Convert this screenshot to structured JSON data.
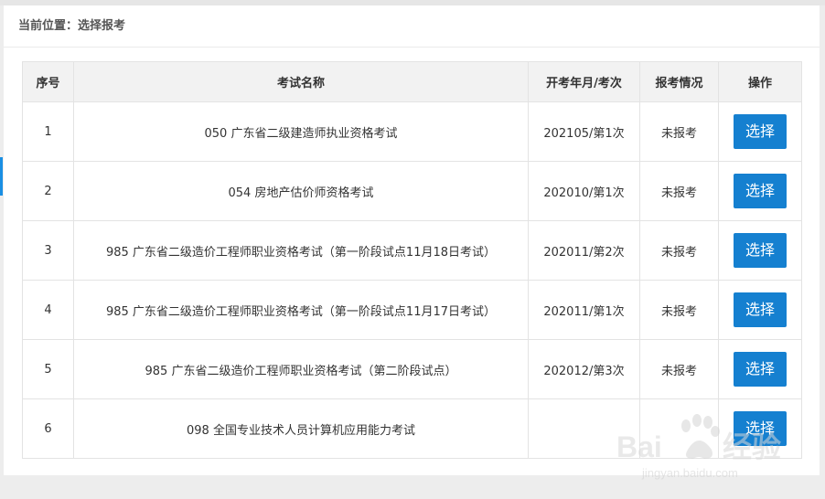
{
  "breadcrumb": {
    "prefix": "当前位置：",
    "current": "选择报考"
  },
  "table": {
    "headers": [
      "序号",
      "考试名称",
      "开考年月/考次",
      "报考情况",
      "操作"
    ],
    "rows": [
      {
        "index": "1",
        "name": "050 广东省二级建造师执业资格考试",
        "period": "202105/第1次",
        "status": "未报考",
        "action": "选择"
      },
      {
        "index": "2",
        "name": "054 房地产估价师资格考试",
        "period": "202010/第1次",
        "status": "未报考",
        "action": "选择"
      },
      {
        "index": "3",
        "name": "985 广东省二级造价工程师职业资格考试（第一阶段试点11月18日考试）",
        "period": "202011/第2次",
        "status": "未报考",
        "action": "选择"
      },
      {
        "index": "4",
        "name": "985 广东省二级造价工程师职业资格考试（第一阶段试点11月17日考试）",
        "period": "202011/第1次",
        "status": "未报考",
        "action": "选择"
      },
      {
        "index": "5",
        "name": "985 广东省二级造价工程师职业资格考试（第二阶段试点）",
        "period": "202012/第3次",
        "status": "未报考",
        "action": "选择"
      },
      {
        "index": "6",
        "name": "098 全国专业技术人员计算机应用能力考试",
        "period": "",
        "status": "",
        "action": "选择"
      }
    ]
  },
  "colors": {
    "button": "#1580d0",
    "accent": "#1a8fe3"
  }
}
